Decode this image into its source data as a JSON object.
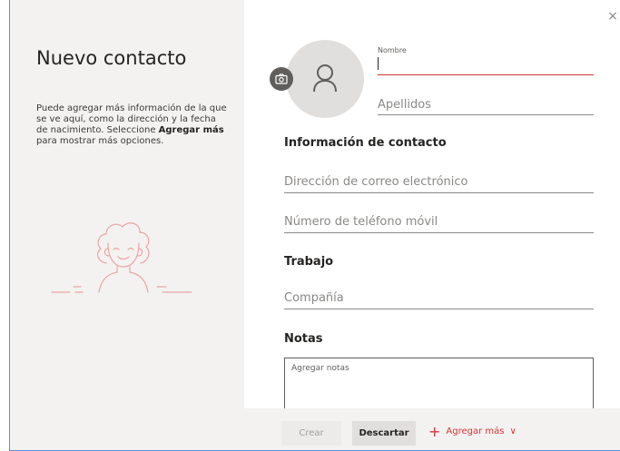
{
  "dialog": {
    "title": "Nuevo contacto",
    "description_part1": "Puede agregar más información de la que se ve aquí, como la dirección y la fecha de nacimiento. Seleccione ",
    "description_bold": "Agregar más",
    "description_part2": " para mostrar más opciones.",
    "close_glyph": "×"
  },
  "form": {
    "first_name_label": "Nombre",
    "first_name_value": "",
    "last_name_placeholder": "Apellidos",
    "contact_section": "Información de contacto",
    "email_placeholder": "Dirección de correo electrónico",
    "phone_placeholder": "Número de teléfono móvil",
    "work_section": "Trabajo",
    "company_placeholder": "Compañía",
    "notes_section": "Notas",
    "notes_placeholder": "Agregar notas"
  },
  "footer": {
    "create_label": "Crear",
    "discard_label": "Descartar",
    "add_more_label": "Agregar más",
    "add_more_plus": "+",
    "add_more_chevron": "∨"
  },
  "colors": {
    "accent": "#d13438",
    "left_pane_bg": "#f3f2f1",
    "avatar_bg": "#e1dfdd",
    "dialog_border": "#5a8fd6"
  },
  "icons": [
    "camera-icon",
    "person-icon",
    "close-icon",
    "plus-icon",
    "chevron-down-icon",
    "person-illustration"
  ]
}
